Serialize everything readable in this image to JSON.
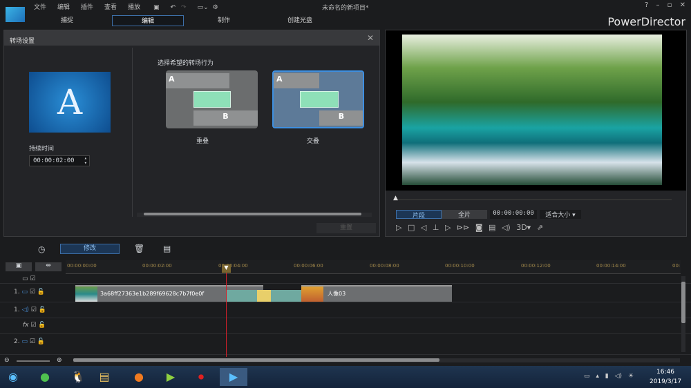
{
  "app": {
    "name": "PowerDirector",
    "title": "未命名的新项目*",
    "menu": [
      "文件",
      "编辑",
      "插件",
      "查看",
      "播放"
    ]
  },
  "tabs": [
    {
      "label": "捕捉"
    },
    {
      "label": "编辑",
      "active": true
    },
    {
      "label": "制作"
    },
    {
      "label": "创建光盘"
    }
  ],
  "transition": {
    "title": "转场设置",
    "duration_label": "持续时间",
    "duration": "00:00:02:00",
    "prompt": "选择希望的转场行为",
    "options": [
      {
        "label": "重叠",
        "selected": false
      },
      {
        "label": "交叠",
        "selected": true
      }
    ],
    "reset_label": "重置",
    "thumb_letter": "A",
    "a": "A",
    "b": "B"
  },
  "preview": {
    "segment": "片段",
    "full": "全片",
    "timecode": "00:00:00:00",
    "fit": "适合大小",
    "three_d": "3D"
  },
  "toolbar": {
    "modify": "修改"
  },
  "timeline": {
    "ticks": [
      "00:00:00:00",
      "00:00:02:00",
      "00:00:04:00",
      "00:00:06:00",
      "00:00:08:00",
      "00:00:10:00",
      "00:00:12:00",
      "00:00:14:00",
      "00:"
    ],
    "tracks": [
      {
        "num": "1."
      },
      {
        "num": "1."
      },
      {
        "num": ""
      },
      {
        "num": "2."
      }
    ],
    "clips": [
      {
        "name": "3a68ff27363e1b289f69628c7b7f0e0f"
      },
      {
        "name": "人像03"
      }
    ],
    "fx": "fx"
  },
  "taskbar": {
    "time": "16:46",
    "date": "2019/3/17"
  },
  "colors": {
    "accent": "#3d6fa8",
    "playhead": "#d0202a",
    "ruler": "#a48a4c"
  }
}
